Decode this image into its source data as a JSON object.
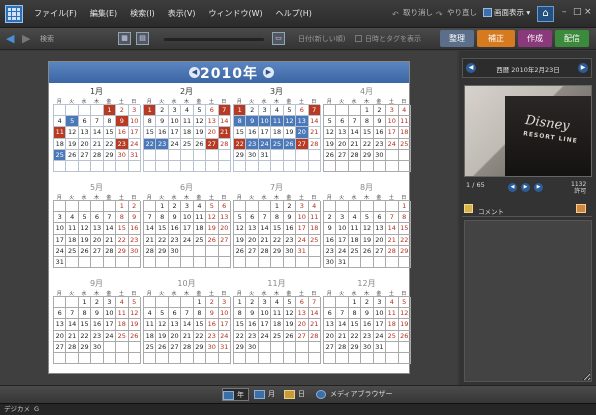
{
  "menu": {
    "items": [
      "ファイル(F)",
      "編集(E)",
      "検索(I)",
      "表示(V)",
      "ウィンドウ(W)",
      "ヘルプ(H)"
    ],
    "undo": "取り消し",
    "redo": "やり直し",
    "screen_display": "画面表示 ▾"
  },
  "toolbar": {
    "search_label": "検索",
    "sort_label": "日付(新しい順)",
    "date_tag_label": "日時とタグを表示"
  },
  "tabs": {
    "organize": "整理",
    "fix": "補正",
    "create": "作成",
    "share": "配信"
  },
  "calendar": {
    "year": "2010年",
    "weekdays": [
      "月",
      "火",
      "水",
      "木",
      "金",
      "土",
      "日"
    ],
    "months": [
      {
        "name": "1月",
        "highlight": true
      },
      {
        "name": "2月",
        "highlight": true
      },
      {
        "name": "3月",
        "highlight": true
      },
      {
        "name": "4月",
        "highlight": false
      },
      {
        "name": "5月",
        "highlight": false
      },
      {
        "name": "6月",
        "highlight": false
      },
      {
        "name": "7月",
        "highlight": false
      },
      {
        "name": "8月",
        "highlight": false
      },
      {
        "name": "9月",
        "highlight": false
      },
      {
        "name": "10月",
        "highlight": false
      },
      {
        "name": "11月",
        "highlight": false
      },
      {
        "name": "12月",
        "highlight": false
      }
    ],
    "selected_days": {
      "1": [
        1,
        5,
        9,
        11,
        23,
        25
      ],
      "2": [
        1,
        7,
        21,
        22,
        23,
        27
      ],
      "3": [
        1,
        7,
        8,
        9,
        10,
        11,
        12,
        13,
        20,
        22,
        23,
        24,
        25,
        26,
        27
      ]
    }
  },
  "sidebar": {
    "date_display": "西暦  2010年2月23日",
    "photo_sign_main": "Disney",
    "photo_sign_sub": "RESORT LINE",
    "counter": "1 / 65",
    "resolution_line1": "1132",
    "resolution_line2": "許可",
    "comment_label": "コメント"
  },
  "bottom": {
    "year_view": "年",
    "month_view": "月",
    "day_view": "日",
    "media_browser": "メディアブラウザー"
  },
  "status": {
    "left": "デジカメ",
    "right": "G"
  }
}
